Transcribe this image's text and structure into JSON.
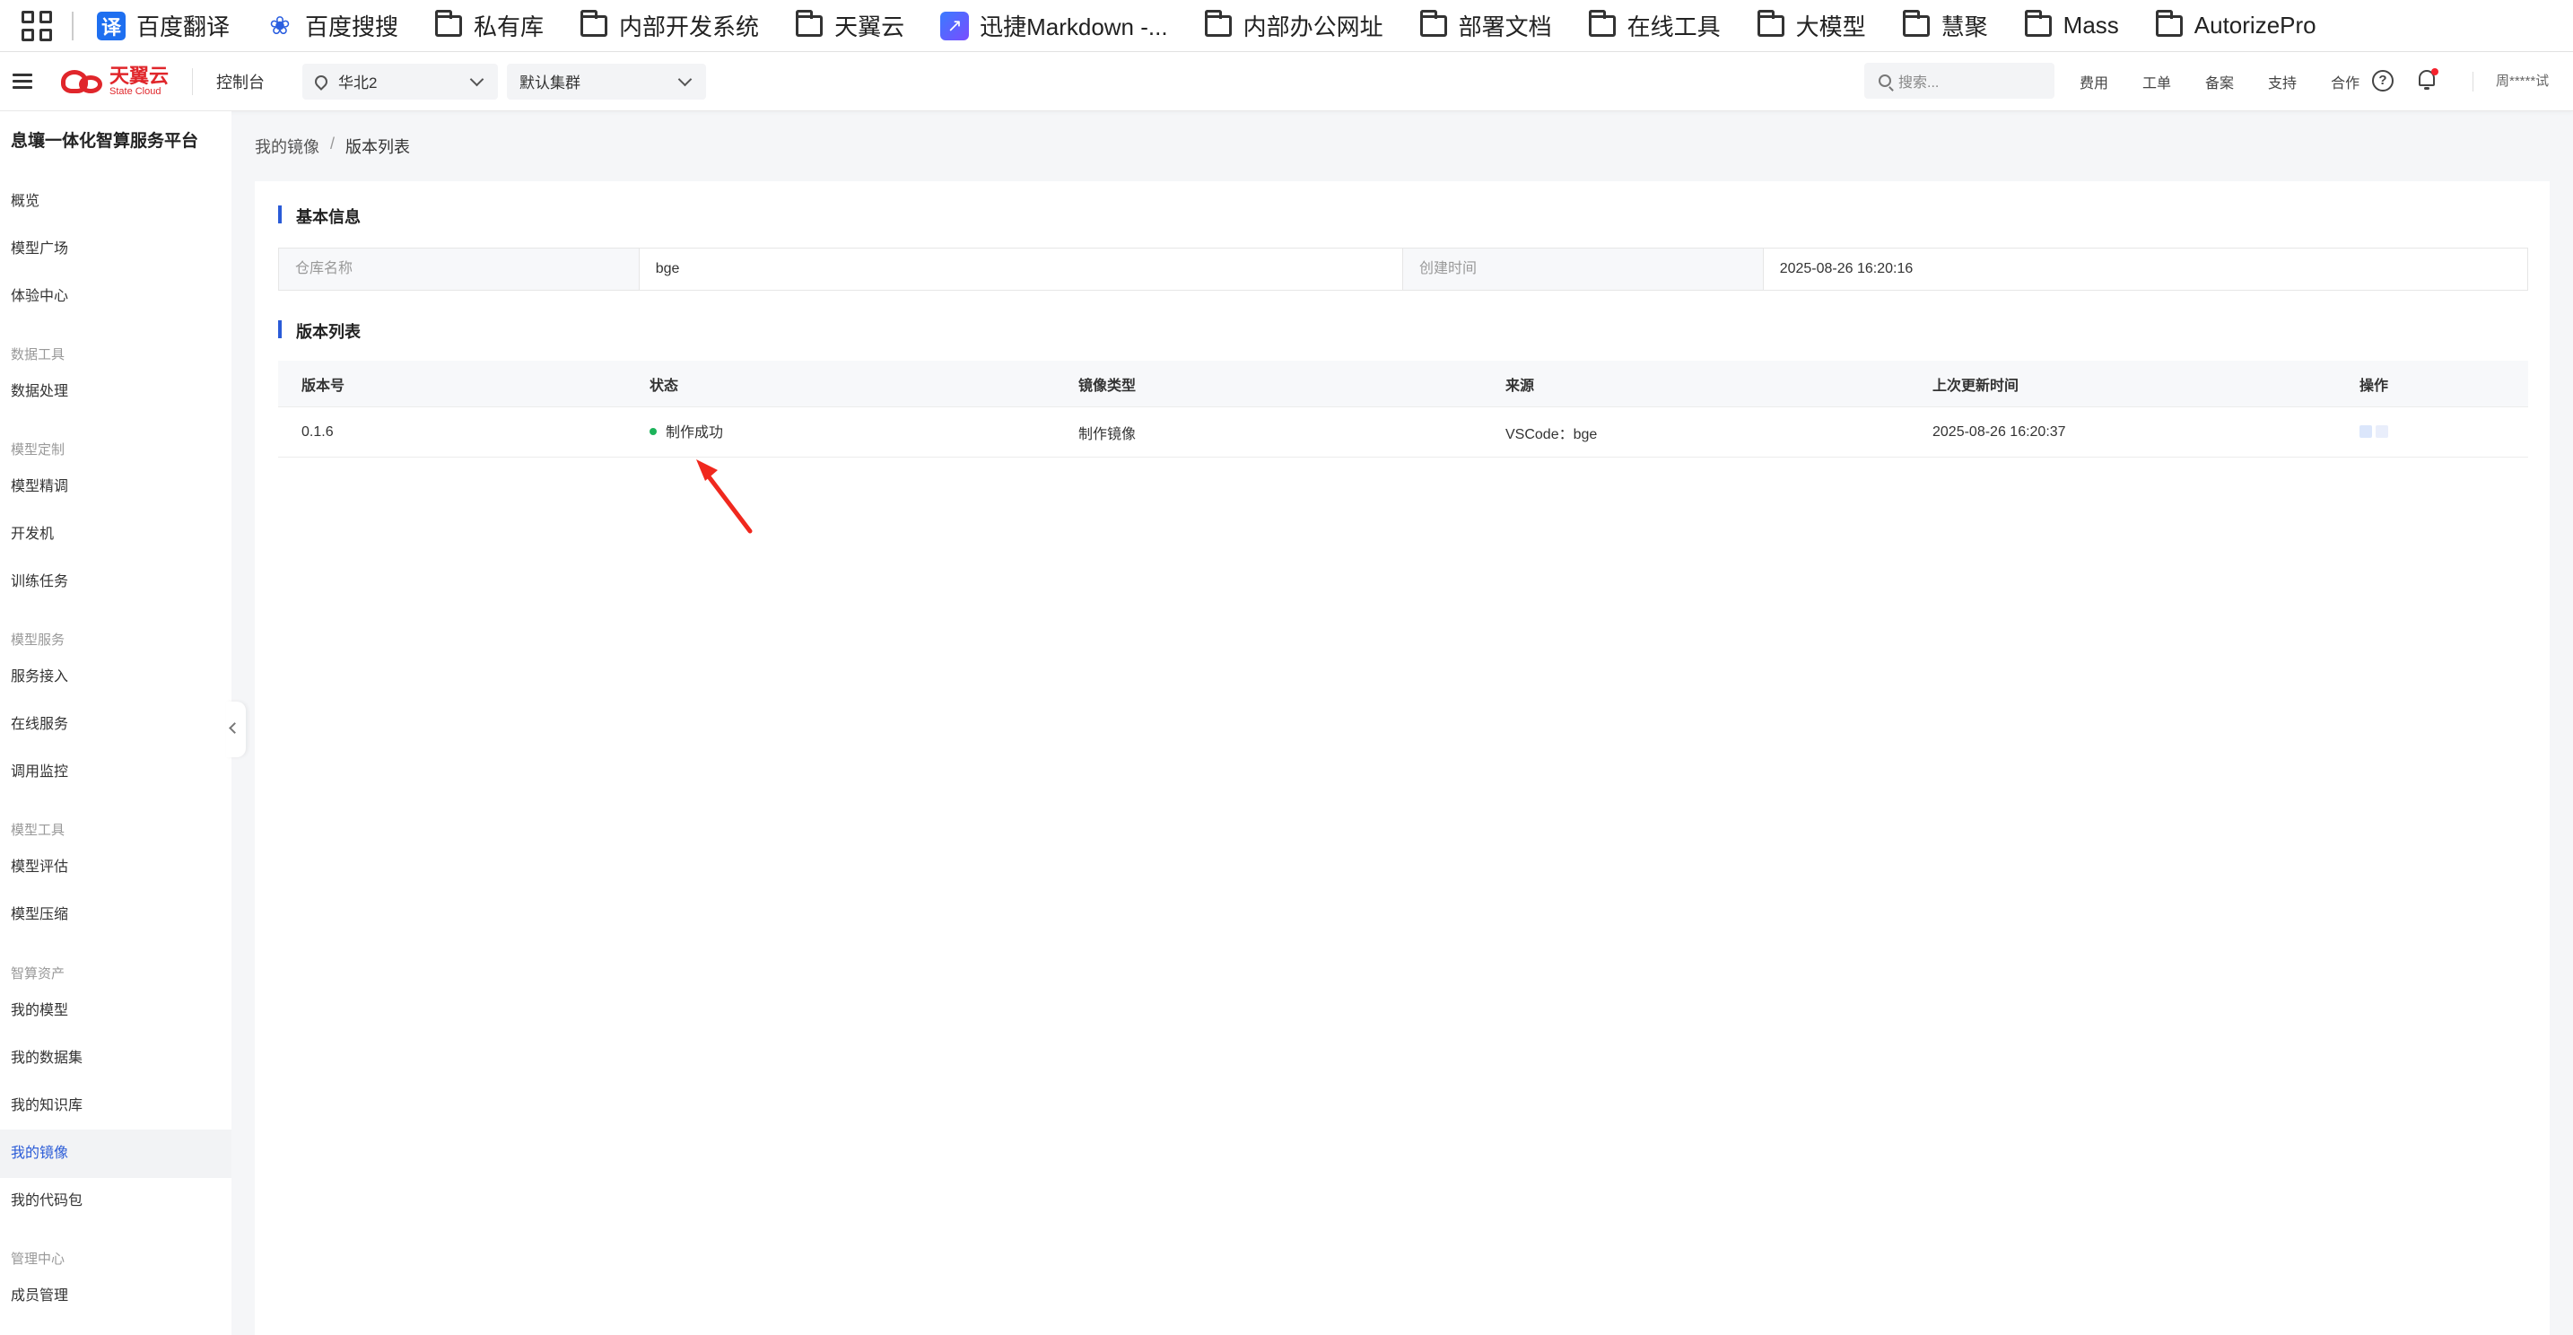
{
  "bookmarks": [
    {
      "label": "百度翻译",
      "icon": "translate-icon",
      "icon_text": "译"
    },
    {
      "label": "百度搜搜",
      "icon": "paw-icon"
    },
    {
      "label": "私有库",
      "icon": "folder-icon"
    },
    {
      "label": "内部开发系统",
      "icon": "folder-icon"
    },
    {
      "label": "天翼云",
      "icon": "folder-icon"
    },
    {
      "label": "迅捷Markdown -...",
      "icon": "markdown-icon"
    },
    {
      "label": "内部办公网址",
      "icon": "folder-icon"
    },
    {
      "label": "部署文档",
      "icon": "folder-icon"
    },
    {
      "label": "在线工具",
      "icon": "folder-icon"
    },
    {
      "label": "大模型",
      "icon": "folder-icon"
    },
    {
      "label": "慧聚",
      "icon": "folder-icon"
    },
    {
      "label": "Mass",
      "icon": "folder-icon"
    },
    {
      "label": "AutorizePro",
      "icon": "folder-icon"
    }
  ],
  "header": {
    "logo_cn": "天翼云",
    "logo_en": "State Cloud",
    "console": "控制台",
    "region": "华北2",
    "cluster": "默认集群",
    "search_placeholder": "搜索...",
    "links": [
      "费用",
      "工单",
      "备案",
      "支持",
      "合作"
    ],
    "help_glyph": "?",
    "user": "周*****试",
    "accent": "#e0262b"
  },
  "sidebar": {
    "title": "息壤一体化智算服务平台",
    "items": [
      {
        "label": "概览"
      },
      {
        "label": "模型广场"
      },
      {
        "label": "体验中心"
      },
      {
        "group": "数据工具"
      },
      {
        "label": "数据处理"
      },
      {
        "group": "模型定制"
      },
      {
        "label": "模型精调"
      },
      {
        "label": "开发机"
      },
      {
        "label": "训练任务"
      },
      {
        "group": "模型服务"
      },
      {
        "label": "服务接入"
      },
      {
        "label": "在线服务"
      },
      {
        "label": "调用监控"
      },
      {
        "group": "模型工具"
      },
      {
        "label": "模型评估"
      },
      {
        "label": "模型压缩"
      },
      {
        "group": "智算资产"
      },
      {
        "label": "我的模型"
      },
      {
        "label": "我的数据集"
      },
      {
        "label": "我的知识库"
      },
      {
        "label": "我的镜像",
        "active": true
      },
      {
        "label": "我的代码包"
      },
      {
        "group": "管理中心"
      },
      {
        "label": "成员管理"
      }
    ]
  },
  "breadcrumb": {
    "parent": "我的镜像",
    "separator": "/",
    "current": "版本列表"
  },
  "basic_info": {
    "title": "基本信息",
    "repo_label": "仓库名称",
    "repo_value": "bge",
    "created_label": "创建时间",
    "created_value": "2025-08-26 16:20:16"
  },
  "version_list": {
    "title": "版本列表",
    "columns": [
      "版本号",
      "状态",
      "镜像类型",
      "来源",
      "上次更新时间",
      "操作"
    ],
    "rows": [
      {
        "version": "0.1.6",
        "status": "制作成功",
        "status_color": "#1cb35a",
        "image_type": "制作镜像",
        "source": "VSCode：bge",
        "updated": "2025-08-26 16:20:37"
      }
    ]
  },
  "colors": {
    "primary": "#2a5bd7",
    "annotation_arrow": "#f0281e"
  }
}
